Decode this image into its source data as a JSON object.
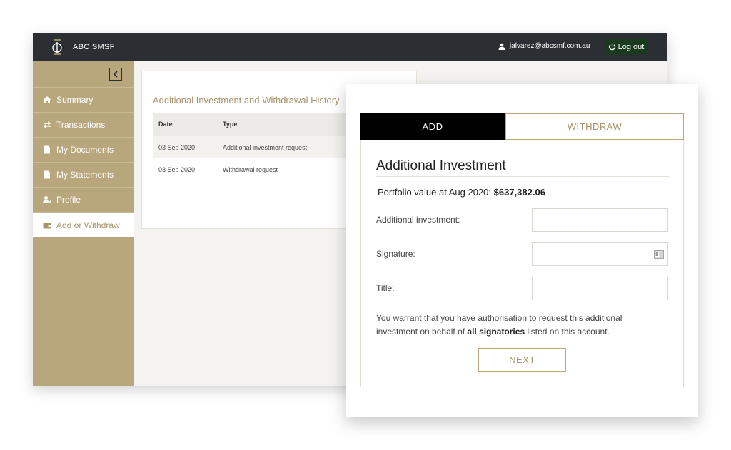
{
  "app": {
    "brand": "ABC SMSF",
    "user_email": "jalvarez@abcsmf.com.au",
    "logout_label": "Log out"
  },
  "sidebar": {
    "items": [
      {
        "label": "Summary",
        "icon": "home-icon"
      },
      {
        "label": "Transactions",
        "icon": "swap-arrows-icon"
      },
      {
        "label": "My Documents",
        "icon": "document-icon"
      },
      {
        "label": "My Statements",
        "icon": "document-icon"
      },
      {
        "label": "Profile",
        "icon": "user-edit-icon"
      },
      {
        "label": "Add or Withdraw",
        "icon": "wallet-icon",
        "active": true
      }
    ]
  },
  "history": {
    "title": "Additional Investment and Withdrawal History",
    "columns": [
      "Date",
      "Type"
    ],
    "rows": [
      {
        "date": "03 Sep 2020",
        "type": "Additional investment request"
      },
      {
        "date": "03 Sep 2020",
        "type": "Withdrawal request"
      }
    ]
  },
  "modal": {
    "tabs": [
      {
        "label": "ADD",
        "active": true
      },
      {
        "label": "WITHDRAW",
        "active": false
      }
    ],
    "form_title": "Additional Investment",
    "portfolio_label": "Portfolio value at Aug 2020:",
    "portfolio_value": "$637,382.06",
    "fields": [
      {
        "label": "Additional investment:",
        "value": "",
        "placeholder": ""
      },
      {
        "label": "Signature:",
        "value": "",
        "placeholder": ""
      },
      {
        "label": "Title:",
        "value": "",
        "placeholder": ""
      }
    ],
    "warrant_prefix": "You warrant that you have authorisation to request this additional investment on behalf of",
    "warrant_bold": "all signatories",
    "warrant_suffix": "listed on this account.",
    "next_label": "NEXT"
  },
  "colors": {
    "topbar": "#2b2f33",
    "gold": "#b8a67c",
    "gold_text": "#a8946a",
    "logout_bg": "#1a3a1e"
  }
}
